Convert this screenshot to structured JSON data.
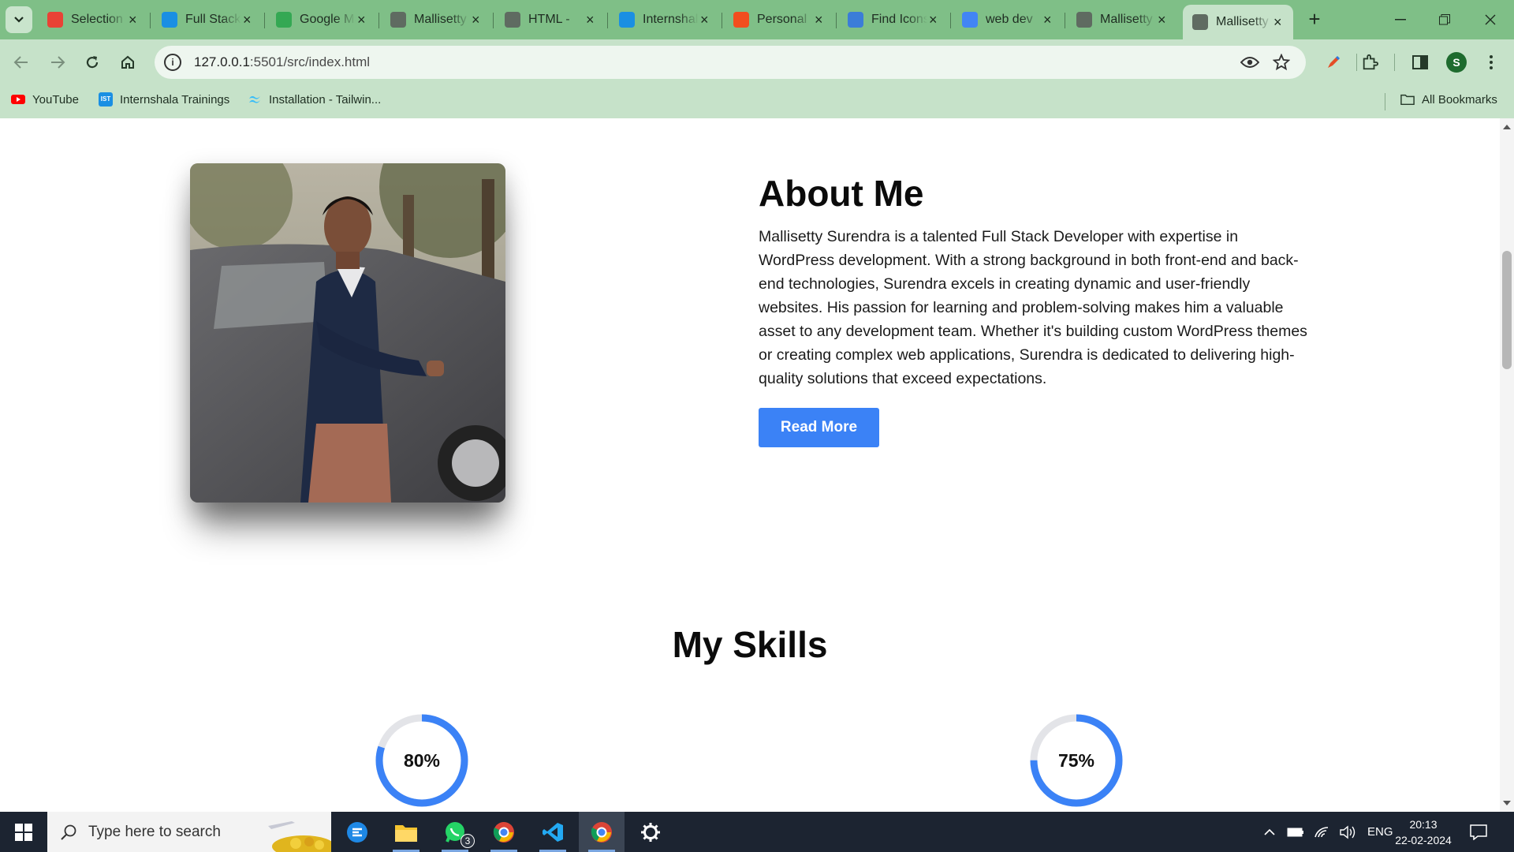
{
  "browser": {
    "tabs": [
      {
        "title": "Selection",
        "favicon": "colorful-grid-icon",
        "color": "#e94235"
      },
      {
        "title": "Full Stack",
        "favicon": "internshala-icon",
        "color": "#1a8fe3"
      },
      {
        "title": "Google Maps",
        "favicon": "maps-icon",
        "color": "#34a853"
      },
      {
        "title": "Mallisetty",
        "favicon": "globe-icon",
        "color": "#5f6b61"
      },
      {
        "title": "HTML -",
        "favicon": "globe-icon",
        "color": "#5f6b61"
      },
      {
        "title": "Internshala",
        "favicon": "internshala-icon",
        "color": "#1a8fe3"
      },
      {
        "title": "Personal",
        "favicon": "figma-icon",
        "color": "#f24e1e"
      },
      {
        "title": "Find Icons",
        "favicon": "flag-icon",
        "color": "#3b7dd8"
      },
      {
        "title": "web dev",
        "favicon": "google-icon",
        "color": "#4285f4"
      },
      {
        "title": "Mallisetty",
        "favicon": "globe-icon",
        "color": "#5f6b61"
      },
      {
        "title": "Mallisetty",
        "favicon": "globe-icon",
        "color": "#5f6b61",
        "active": true
      }
    ],
    "url_host": "127.0.0.1",
    "url_path": ":5501/src/index.html",
    "profile_initial": "S",
    "bookmarks": [
      {
        "label": "YouTube"
      },
      {
        "label": "Internshala Trainings"
      },
      {
        "label": "Installation - Tailwin..."
      }
    ],
    "all_bookmarks_label": "All Bookmarks"
  },
  "page": {
    "about": {
      "title": "About Me",
      "text": "Mallisetty Surendra is a talented Full Stack Developer with expertise in WordPress development. With a strong background in both front-end and back-end technologies, Surendra excels in creating dynamic and user-friendly websites. His passion for learning and problem-solving makes him a valuable asset to any development team. Whether it's building custom WordPress themes or creating complex web applications, Surendra is dedicated to delivering high-quality solutions that exceed expectations.",
      "button_label": "Read More",
      "accent": "#3b82f6"
    },
    "skills": {
      "title": "My Skills",
      "items": [
        {
          "percent_label": "80%",
          "value": 80
        },
        {
          "percent_label": "75%",
          "value": 75
        }
      ]
    }
  },
  "taskbar": {
    "search_placeholder": "Type here to search",
    "whatsapp_badge": "3",
    "language": "ENG",
    "time": "20:13",
    "date": "22-02-2024"
  }
}
